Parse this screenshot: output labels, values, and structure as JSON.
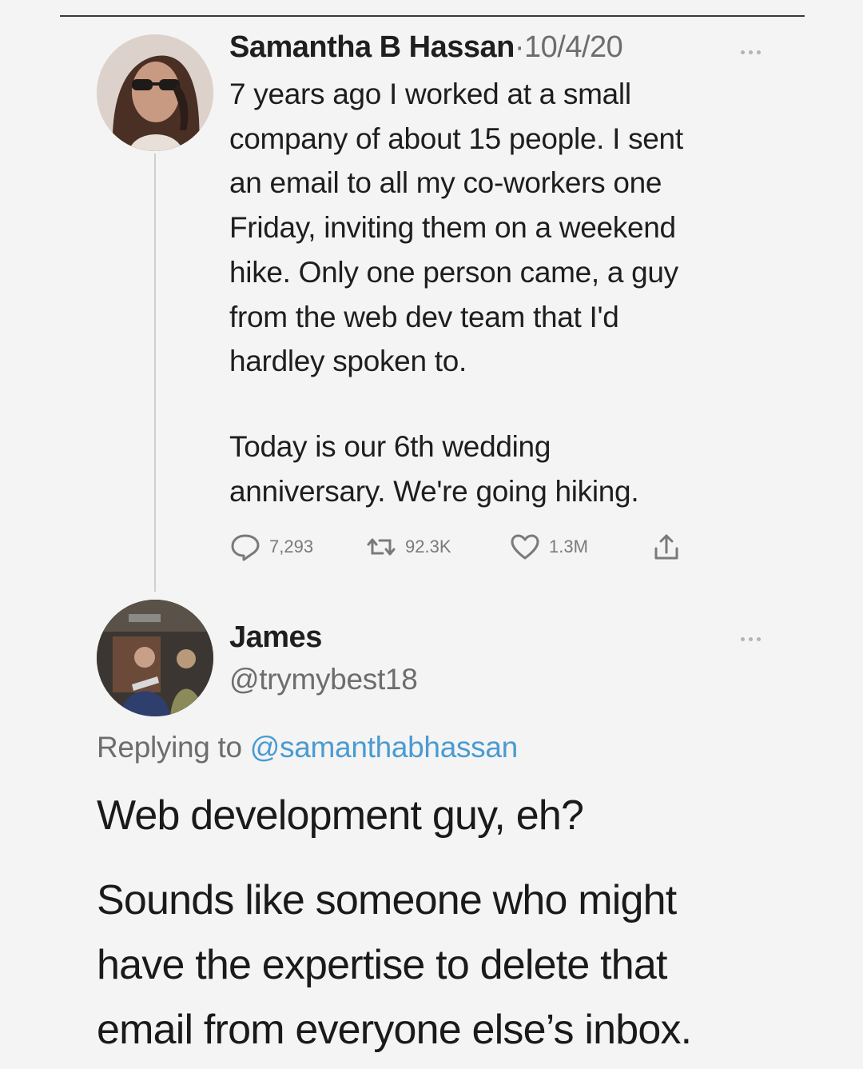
{
  "tweet": {
    "author_name": "Samantha B Hassan",
    "separator": "·",
    "date": "10/4/20",
    "text_lines_1": [
      "7 years ago I worked at a small",
      "company of about 15 people. I sent",
      "an email to all my co-workers one",
      "Friday, inviting them on a weekend",
      "hike. Only one person came, a guy",
      "from the web dev team that I'd",
      "hardley spoken to."
    ],
    "text_lines_2": [
      "Today is our 6th wedding",
      "anniversary. We're going hiking."
    ],
    "actions": {
      "replies": "7,293",
      "retweets": "92.3K",
      "likes": "1.3M"
    },
    "icons": [
      "more-icon",
      "reply-icon",
      "retweet-icon",
      "like-icon",
      "share-icon"
    ]
  },
  "reply": {
    "author_name": "James",
    "handle": "@trymybest18",
    "replying_prefix": "Replying to",
    "replying_mention": "@samanthabhassan",
    "text_lines_1": [
      "Web development guy, eh?"
    ],
    "text_lines_2": [
      "Sounds like someone who might",
      "have the expertise to delete that",
      "email from everyone else’s inbox."
    ]
  },
  "colors": {
    "background": "#f4f4f4",
    "text": "#1a1a1a",
    "secondary_text": "#6d6d6d",
    "mention": "#4a9bd1",
    "thread_line": "#cfcfcf"
  }
}
